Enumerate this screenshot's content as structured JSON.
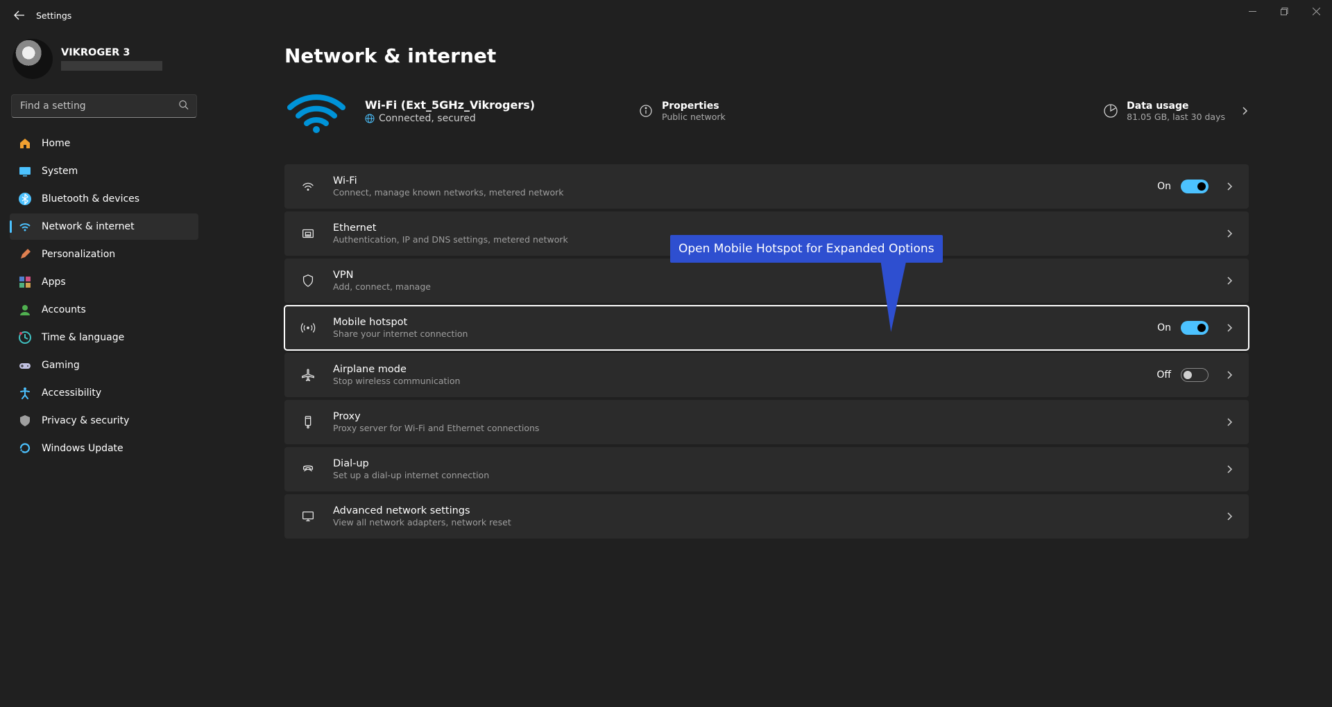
{
  "app": {
    "title": "Settings"
  },
  "user": {
    "name": "VIKROGER 3"
  },
  "search": {
    "placeholder": "Find a setting"
  },
  "sidebar": {
    "items": [
      {
        "label": "Home",
        "icon": "home"
      },
      {
        "label": "System",
        "icon": "system"
      },
      {
        "label": "Bluetooth & devices",
        "icon": "bluetooth"
      },
      {
        "label": "Network & internet",
        "icon": "wifi",
        "active": true
      },
      {
        "label": "Personalization",
        "icon": "brush"
      },
      {
        "label": "Apps",
        "icon": "apps"
      },
      {
        "label": "Accounts",
        "icon": "person"
      },
      {
        "label": "Time & language",
        "icon": "clock"
      },
      {
        "label": "Gaming",
        "icon": "gamepad"
      },
      {
        "label": "Accessibility",
        "icon": "accessibility"
      },
      {
        "label": "Privacy & security",
        "icon": "shield"
      },
      {
        "label": "Windows Update",
        "icon": "update"
      }
    ]
  },
  "page": {
    "title": "Network & internet"
  },
  "status": {
    "name": "Wi-Fi (Ext_5GHz_Vikrogers)",
    "state": "Connected, secured",
    "properties": {
      "label": "Properties",
      "sub": "Public network"
    },
    "usage": {
      "label": "Data usage",
      "sub": "81.05 GB, last 30 days"
    }
  },
  "cards": [
    {
      "key": "wifi",
      "icon": "wifi",
      "title": "Wi-Fi",
      "sub": "Connect, manage known networks, metered network",
      "toggle": "On"
    },
    {
      "key": "eth",
      "icon": "ethernet",
      "title": "Ethernet",
      "sub": "Authentication, IP and DNS settings, metered network"
    },
    {
      "key": "vpn",
      "icon": "shield",
      "title": "VPN",
      "sub": "Add, connect, manage"
    },
    {
      "key": "hotspot",
      "icon": "hotspot",
      "title": "Mobile hotspot",
      "sub": "Share your internet connection",
      "toggle": "On",
      "highlight": true
    },
    {
      "key": "air",
      "icon": "airplane",
      "title": "Airplane mode",
      "sub": "Stop wireless communication",
      "toggle": "Off"
    },
    {
      "key": "proxy",
      "icon": "proxy",
      "title": "Proxy",
      "sub": "Proxy server for Wi-Fi and Ethernet connections"
    },
    {
      "key": "dial",
      "icon": "dialup",
      "title": "Dial-up",
      "sub": "Set up a dial-up internet connection"
    },
    {
      "key": "adv",
      "icon": "monitor",
      "title": "Advanced network settings",
      "sub": "View all network adapters, network reset"
    }
  ],
  "callout": {
    "text": "Open Mobile Hotspot for Expanded Options"
  },
  "colors": {
    "accent": "#4cc2ff",
    "calloutBg": "#2e4fd0"
  }
}
